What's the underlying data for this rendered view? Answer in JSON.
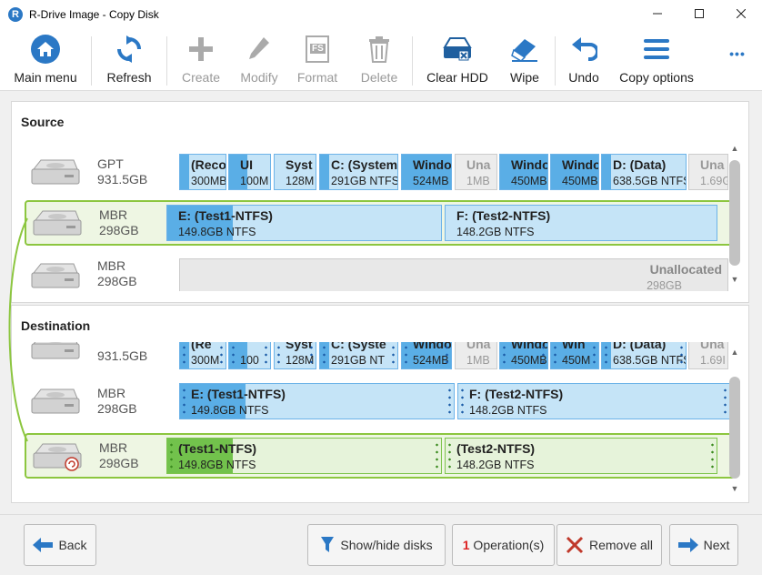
{
  "window": {
    "title": "R-Drive Image - Copy Disk",
    "app_icon_letter": "R"
  },
  "toolbar": {
    "main_menu": "Main menu",
    "refresh": "Refresh",
    "create": "Create",
    "modify": "Modify",
    "format": "Format",
    "format_icon_text": "FS",
    "delete": "Delete",
    "clear_hdd": "Clear HDD",
    "wipe": "Wipe",
    "undo": "Undo",
    "copy_options": "Copy options",
    "more": "•••"
  },
  "source": {
    "title": "Source",
    "disks": [
      {
        "type": "GPT",
        "size": "931.5GB",
        "partitions": [
          {
            "name": "(Reco",
            "size": "300MB"
          },
          {
            "name": "UI",
            "size": "100M"
          },
          {
            "name": "Syst",
            "size": "128M"
          },
          {
            "name": "C: (System",
            "size": "291GB NTFS"
          },
          {
            "name": "Windo",
            "size": "524MB"
          },
          {
            "name": "Una",
            "size": "1MB"
          },
          {
            "name": "Windo",
            "size": "450MB"
          },
          {
            "name": "Windo",
            "size": "450MB"
          },
          {
            "name": "D: (Data)",
            "size": "638.5GB NTFS"
          },
          {
            "name": "Una",
            "size": "1.69G"
          }
        ]
      },
      {
        "type": "MBR",
        "size": "298GB",
        "partitions": [
          {
            "name": "E: (Test1-NTFS)",
            "size": "149.8GB NTFS"
          },
          {
            "name": "F: (Test2-NTFS)",
            "size": "148.2GB NTFS"
          }
        ]
      },
      {
        "type": "MBR",
        "size": "298GB",
        "partitions": [
          {
            "name": "Unallocated",
            "size": "298GB"
          }
        ]
      }
    ]
  },
  "destination": {
    "title": "Destination",
    "disks": [
      {
        "type": "",
        "size": "931.5GB",
        "partitions": [
          {
            "name": "(Re",
            "size": "300M"
          },
          {
            "name": "",
            "size": "100"
          },
          {
            "name": "Syst",
            "size": "128M"
          },
          {
            "name": "C: (Syste",
            "size": "291GB NT"
          },
          {
            "name": "Windo",
            "size": "524MB"
          },
          {
            "name": "Una",
            "size": "1MB"
          },
          {
            "name": "Windo",
            "size": "450MB"
          },
          {
            "name": "Win",
            "size": "450M"
          },
          {
            "name": "D: (Data)",
            "size": "638.5GB NTFS"
          },
          {
            "name": "Una",
            "size": "1.69I"
          }
        ]
      },
      {
        "type": "MBR",
        "size": "298GB",
        "partitions": [
          {
            "name": "E: (Test1-NTFS)",
            "size": "149.8GB NTFS"
          },
          {
            "name": "F: (Test2-NTFS)",
            "size": "148.2GB NTFS"
          }
        ]
      },
      {
        "type": "MBR",
        "size": "298GB",
        "partitions": [
          {
            "name": "(Test1-NTFS)",
            "size": "149.8GB NTFS"
          },
          {
            "name": "(Test2-NTFS)",
            "size": "148.2GB NTFS"
          }
        ]
      }
    ]
  },
  "footer": {
    "back": "Back",
    "show_hide": "Show/hide disks",
    "operations_count": "1",
    "operations_label": " Operation(s)",
    "remove_all": "Remove all",
    "next": "Next"
  },
  "colors": {
    "accent_blue": "#2b78c5",
    "partition_fill": "#5aaee6",
    "selection_green": "#8cc63f",
    "new_partition_green": "#72c24c"
  }
}
